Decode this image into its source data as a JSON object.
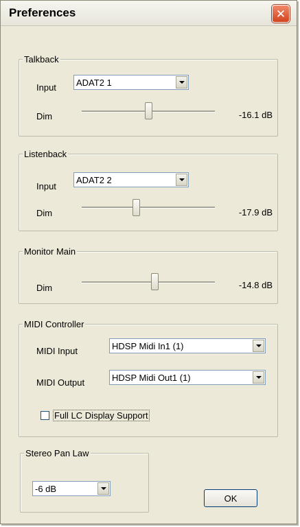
{
  "window": {
    "title": "Preferences",
    "close_icon": "close-icon"
  },
  "talkback": {
    "group_label": "Talkback",
    "input_label": "Input",
    "input_value": "ADAT2 1",
    "dim_label": "Dim",
    "dim_value": "-16.1 dB",
    "dim_slider_fraction": 0.5
  },
  "listenback": {
    "group_label": "Listenback",
    "input_label": "Input",
    "input_value": "ADAT2 2",
    "dim_label": "Dim",
    "dim_value": "-17.9 dB",
    "dim_slider_fraction": 0.41
  },
  "monitor_main": {
    "group_label": "Monitor Main",
    "dim_label": "Dim",
    "dim_value": "-14.8 dB",
    "dim_slider_fraction": 0.55
  },
  "midi_controller": {
    "group_label": "MIDI Controller",
    "input_label": "MIDI Input",
    "input_value": "HDSP Midi In1 (1)",
    "output_label": "MIDI Output",
    "output_value": "HDSP Midi Out1 (1)",
    "full_lc_label": "Full LC Display Support",
    "full_lc_checked": false
  },
  "stereo_pan_law": {
    "group_label": "Stereo Pan Law",
    "value": "-6 dB"
  },
  "ok_button": {
    "label": "OK"
  }
}
